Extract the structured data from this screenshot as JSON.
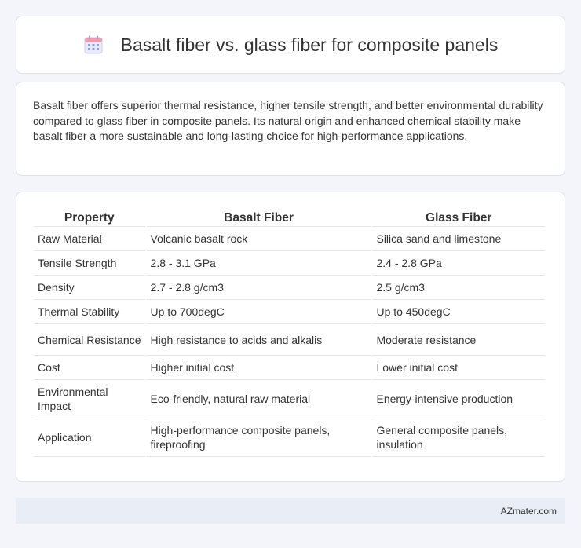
{
  "header": {
    "title": "Basalt fiber vs. glass fiber for composite panels",
    "icon": "calendar-icon"
  },
  "summary": {
    "text": "Basalt fiber offers superior thermal resistance, higher tensile strength, and better environmental durability compared to glass fiber in composite panels. Its natural origin and enhanced chemical stability make basalt fiber a more sustainable and long-lasting choice for high-performance applications."
  },
  "table": {
    "headers": [
      "Property",
      "Basalt Fiber",
      "Glass Fiber"
    ],
    "rows": [
      [
        "Raw Material",
        "Volcanic basalt rock",
        "Silica sand and limestone"
      ],
      [
        "Tensile Strength",
        "2.8 - 3.1 GPa",
        "2.4 - 2.8 GPa"
      ],
      [
        "Density",
        "2.7 - 2.8 g/cm3",
        "2.5 g/cm3"
      ],
      [
        "Thermal Stability",
        "Up to 700degC",
        "Up to 450degC"
      ],
      [
        "Chemical Resistance",
        "High resistance to acids and alkalis",
        "Moderate resistance"
      ],
      [
        "Cost",
        "Higher initial cost",
        "Lower initial cost"
      ],
      [
        "Environmental Impact",
        "Eco-friendly, natural raw material",
        "Energy-intensive production"
      ],
      [
        "Application",
        "High-performance composite panels, fireproofing",
        "General composite panels, insulation"
      ]
    ]
  },
  "footer": {
    "brand": "AZmater.com"
  },
  "colors": {
    "background": "#f3f5fa",
    "card": "#ffffff",
    "footer": "#e9edf5",
    "icon_accent": "#7b8fe0"
  }
}
